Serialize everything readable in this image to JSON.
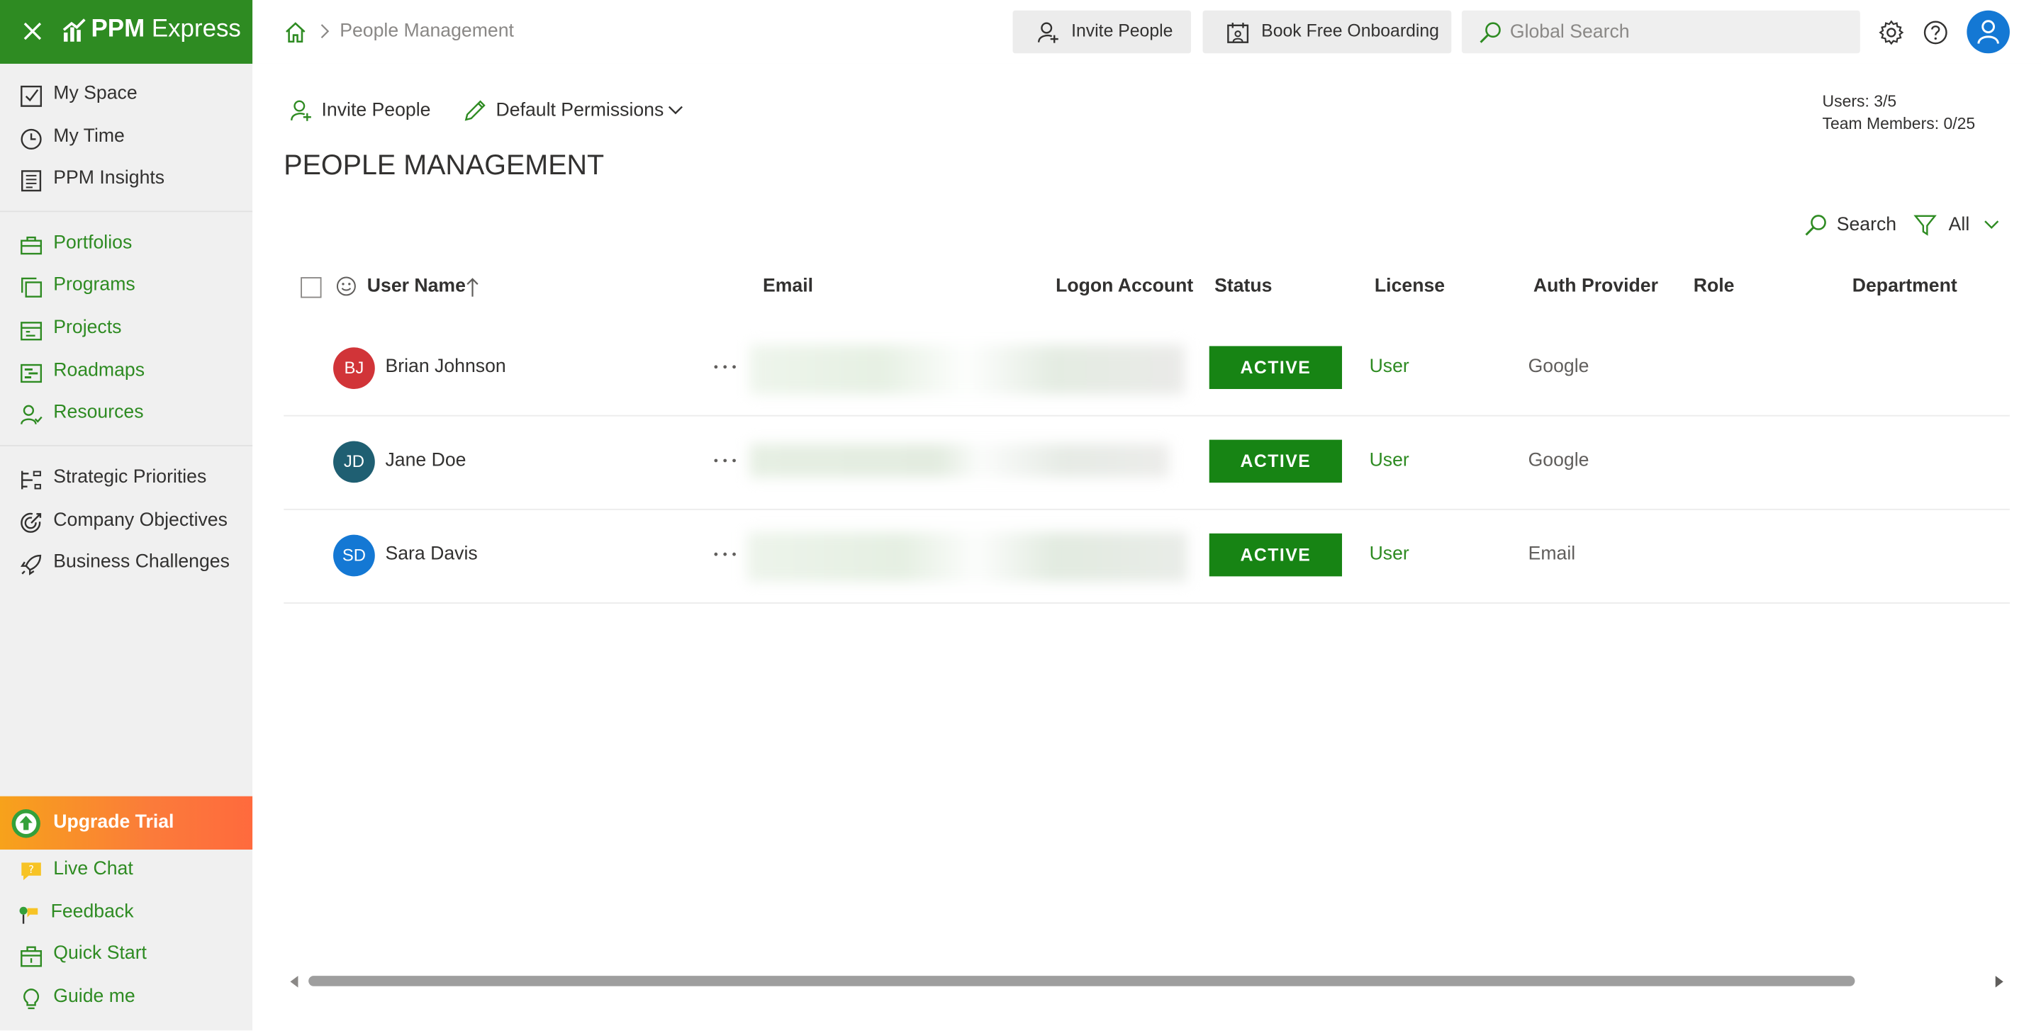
{
  "brand": {
    "name_bold": "PPM",
    "name_rest": " Express",
    "color": "#2e8b22"
  },
  "sidebar": {
    "top_items": [
      {
        "label": "My Space",
        "icon": "checkbox-icon"
      },
      {
        "label": "My Time",
        "icon": "clock-icon"
      },
      {
        "label": "PPM Insights",
        "icon": "report-icon"
      }
    ],
    "work_items": [
      {
        "label": "Portfolios",
        "icon": "portfolio-icon"
      },
      {
        "label": "Programs",
        "icon": "programs-icon"
      },
      {
        "label": "Projects",
        "icon": "projects-icon"
      },
      {
        "label": "Roadmaps",
        "icon": "roadmap-icon"
      },
      {
        "label": "Resources",
        "icon": "resources-icon"
      }
    ],
    "strategy_items": [
      {
        "label": "Strategic Priorities",
        "icon": "priorities-icon"
      },
      {
        "label": "Company Objectives",
        "icon": "target-icon"
      },
      {
        "label": "Business Challenges",
        "icon": "rocket-icon"
      }
    ],
    "upgrade": {
      "label": "Upgrade Trial",
      "icon": "upgrade-arrow-icon"
    },
    "bottom_items": [
      {
        "label": "Live Chat",
        "icon": "chat-icon"
      },
      {
        "label": "Feedback",
        "icon": "feedback-icon"
      },
      {
        "label": "Quick Start",
        "icon": "quick-start-icon"
      },
      {
        "label": "Guide me",
        "icon": "lightbulb-icon"
      }
    ]
  },
  "topbar": {
    "breadcrumb": "People Management",
    "invite_label": "Invite People",
    "onboarding_label": "Book Free Onboarding",
    "search_placeholder": "Global Search"
  },
  "main": {
    "commands": {
      "invite": "Invite People",
      "permissions": "Default Permissions"
    },
    "counts": {
      "users": "Users: 3/5",
      "team_members": "Team Members: 0/25"
    },
    "title": "PEOPLE MANAGEMENT",
    "table_search": "Search",
    "filter": "All",
    "columns": [
      "User Name",
      "Email",
      "Logon Account",
      "Status",
      "License",
      "Auth Provider",
      "Role",
      "Department"
    ],
    "rows": [
      {
        "initials": "BJ",
        "avatar_color": "#d13438",
        "name": "Brian Johnson",
        "status": "ACTIVE",
        "license": "User",
        "auth": "Google"
      },
      {
        "initials": "JD",
        "avatar_color": "#1f5f72",
        "name": "Jane Doe",
        "status": "ACTIVE",
        "license": "User",
        "auth": "Google"
      },
      {
        "initials": "SD",
        "avatar_color": "#1478d4",
        "name": "Sara Davis",
        "status": "ACTIVE",
        "license": "User",
        "auth": "Email"
      }
    ]
  },
  "colors": {
    "accent": "#2e8b22",
    "status": "#178414",
    "upgrade": "#fb7b3a",
    "avatar": "#1478d4"
  }
}
